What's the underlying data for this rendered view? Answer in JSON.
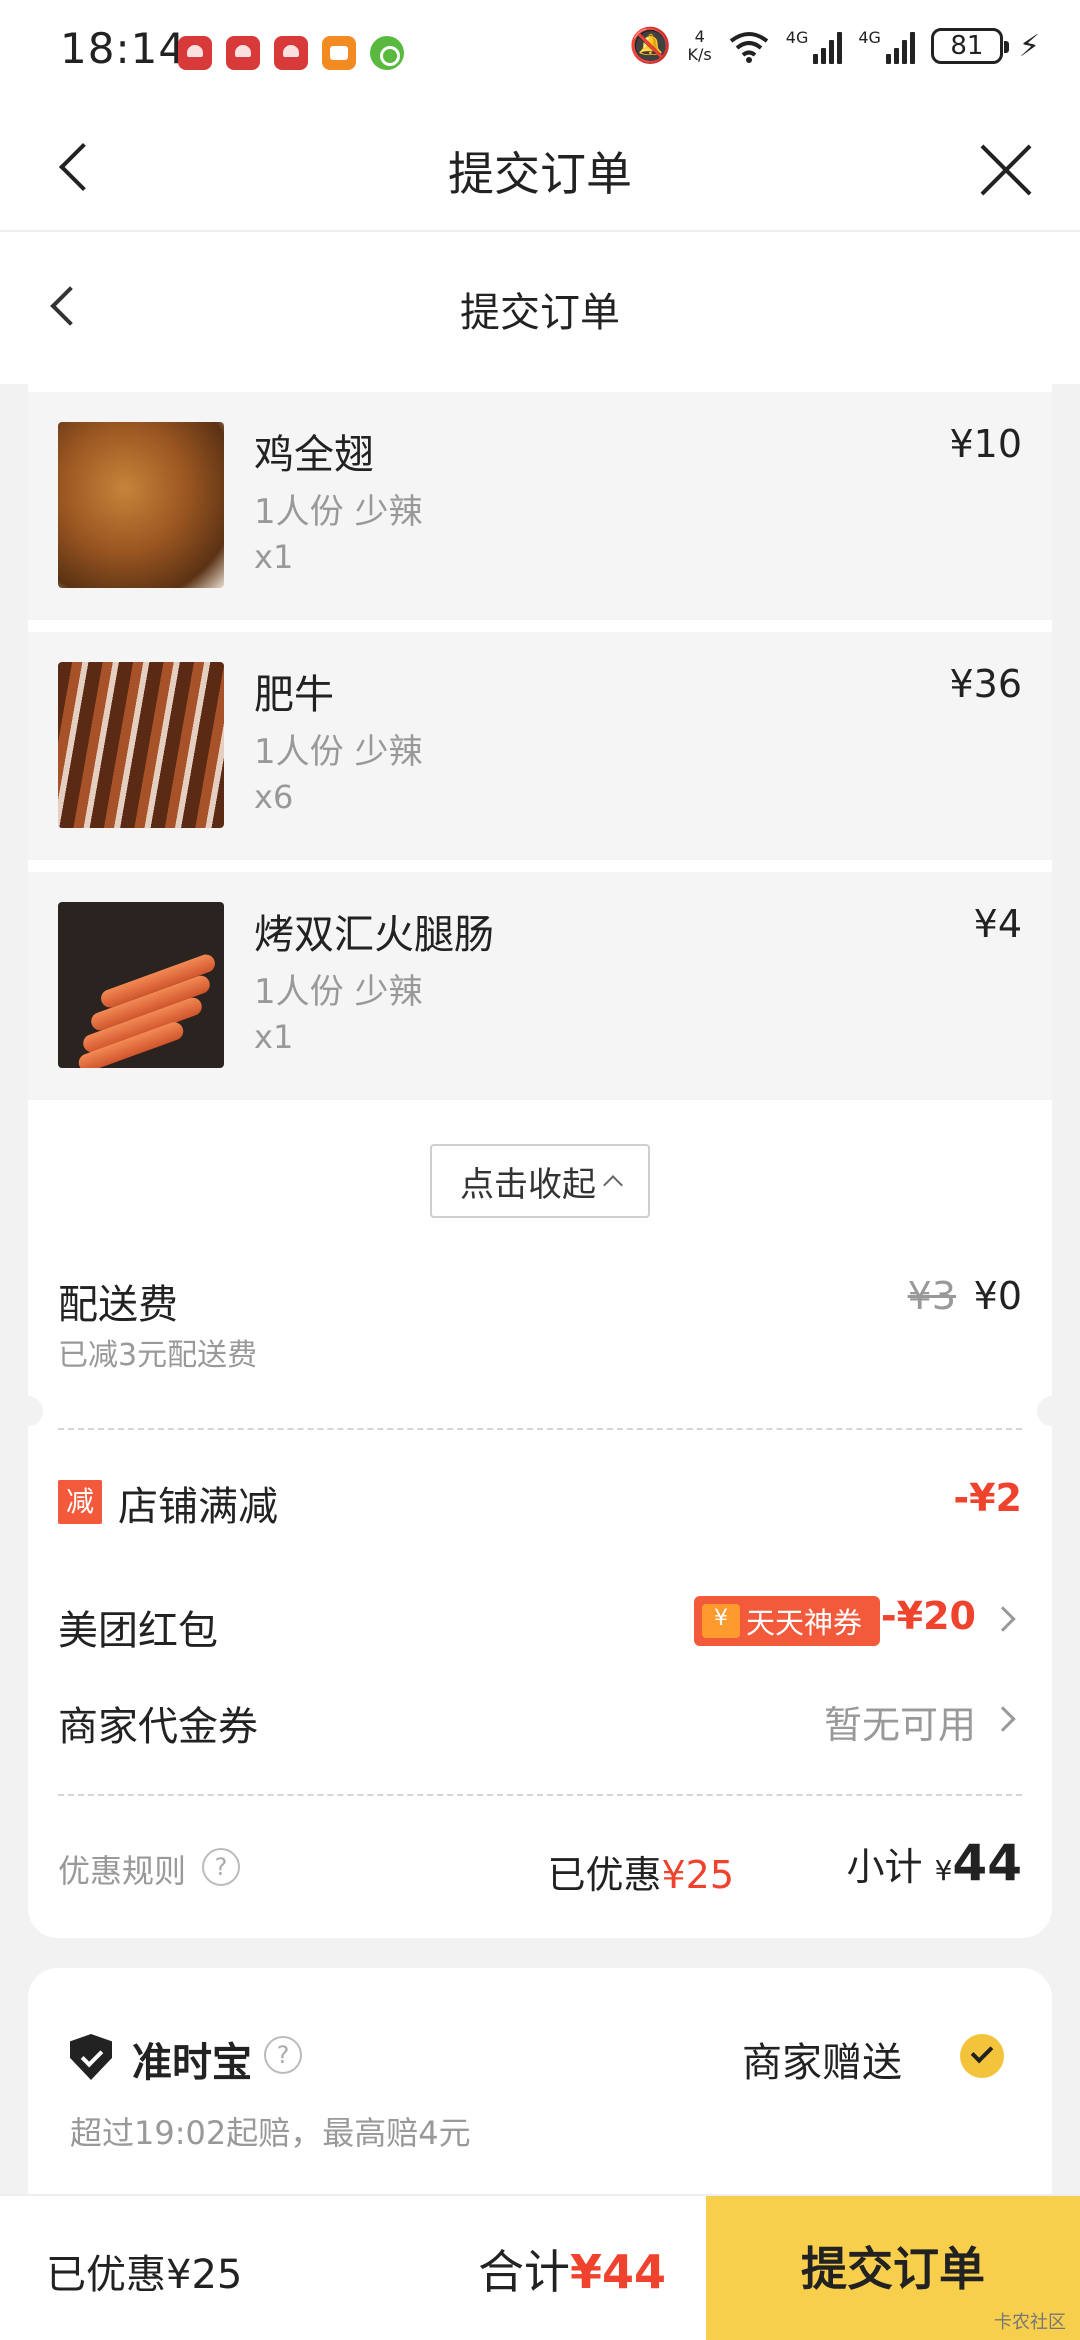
{
  "status_bar": {
    "time": "18:14",
    "net_speed_value": "4",
    "net_speed_unit": "K/s",
    "signal1_label": "4G",
    "signal2_label": "4G",
    "battery": "81"
  },
  "header_outer": {
    "title": "提交订单"
  },
  "header_inner": {
    "title": "提交订单"
  },
  "items": [
    {
      "name": "鸡全翅",
      "spec": "1人份 少辣",
      "qty": "x1",
      "price": "¥10"
    },
    {
      "name": "肥牛",
      "spec": "1人份 少辣",
      "qty": "x6",
      "price": "¥36"
    },
    {
      "name": "烤双汇火腿肠",
      "spec": "1人份 少辣",
      "qty": "x1",
      "price": "¥4"
    }
  ],
  "collapse_label": "点击收起",
  "delivery": {
    "label": "配送费",
    "sub": "已减3元配送费",
    "original": "¥3",
    "value": "¥0"
  },
  "shop_promo": {
    "badge": "减",
    "label": "店铺满减",
    "value": "-¥2"
  },
  "red_packet": {
    "label": "美团红包",
    "tag": "天天神券",
    "value": "-¥20"
  },
  "merchant_voucher": {
    "label": "商家代金券",
    "value": "暂无可用"
  },
  "summary": {
    "rules_label": "优惠规则",
    "saved_prefix": "已优惠",
    "saved_value": "¥25",
    "subtotal_label": "小计",
    "subtotal_currency": "¥",
    "subtotal_value": "44"
  },
  "ontime": {
    "label": "准时宝",
    "right": "商家赠送",
    "desc": "超过19:02起赔，最高赔4元"
  },
  "bottom": {
    "saved": "已优惠¥25",
    "total_label": "合计",
    "total_value": "¥44",
    "submit": "提交订单"
  },
  "watermark": "卡农社区",
  "colors": {
    "accent_red": "#f0432d",
    "submit_yellow": "#f8cf4c"
  }
}
